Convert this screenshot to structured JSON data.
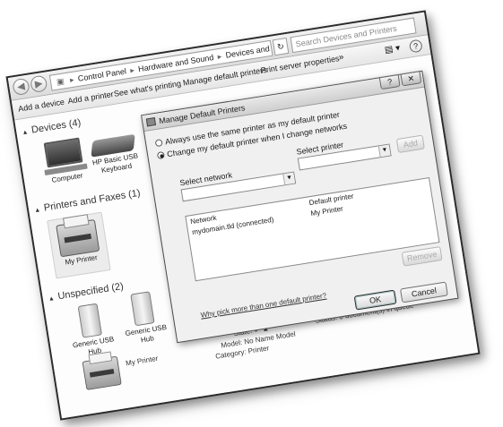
{
  "window": {
    "back_glyph": "◀",
    "forward_glyph": "▶",
    "breadcrumbs": [
      "Control Panel",
      "Hardware and Sound",
      "Devices and Printers"
    ],
    "search_placeholder": "Search Devices and Printers"
  },
  "toolbar": {
    "add_device": "Add a device",
    "add_printer": "Add a printer",
    "see_printing": "See what's printing",
    "manage_default": "Manage default printers",
    "server_props": "Print server properties",
    "more": "»"
  },
  "groups": {
    "devices": {
      "label": "Devices (4)",
      "items": [
        "Computer",
        "HP Basic USB Keyboard"
      ]
    },
    "printers": {
      "label": "Printers and Faxes (1)",
      "items": [
        "My Printer"
      ]
    },
    "unspecified": {
      "label": "Unspecified (2)",
      "items": [
        "Generic USB Hub",
        "Generic USB Hub"
      ]
    }
  },
  "details": {
    "device_name": "My Printer",
    "state_label": "State:",
    "model_label": "Model:",
    "model_value": "No Name Model",
    "category_label": "Category:",
    "category_value": "Printer",
    "status_label": "Status:",
    "status_value": "0 document(s) in queue"
  },
  "dialog": {
    "title": "Manage Default Printers",
    "radio_same": "Always use the same printer as my default printer",
    "radio_change": "Change my default printer when I change networks",
    "select_network_label": "Select network",
    "select_printer_label": "Select printer",
    "add_button": "Add",
    "col_network": "Network",
    "col_default": "Default printer",
    "row_network": "mydomain.tld (connected)",
    "row_printer": "My Printer",
    "remove_button": "Remove",
    "help_link": "Why pick more than one default printer?",
    "ok_button": "OK",
    "cancel_button": "Cancel",
    "close_glyph": "✕"
  }
}
